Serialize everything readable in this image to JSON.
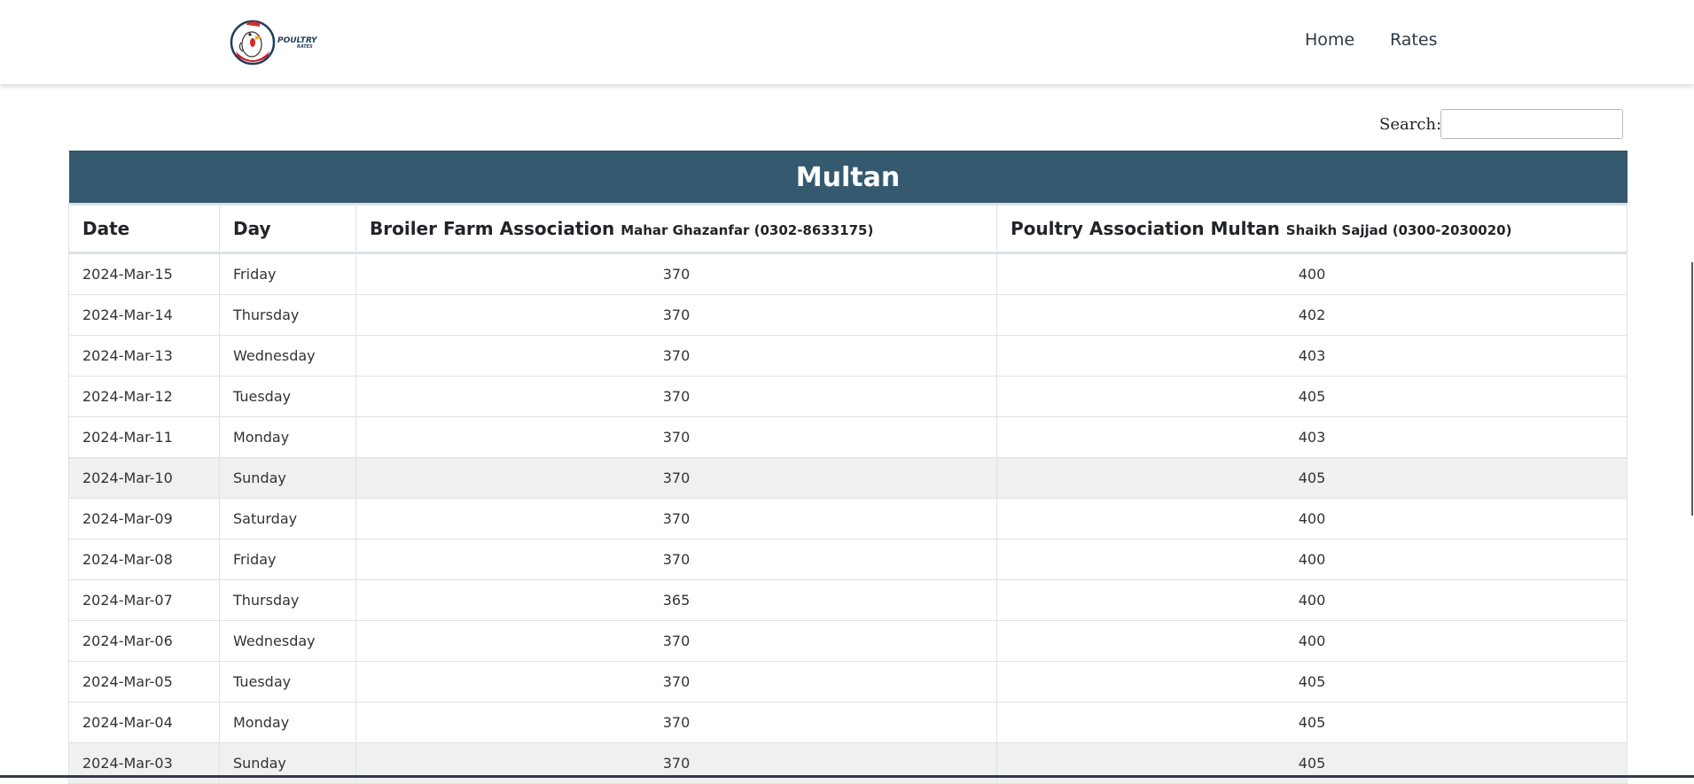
{
  "nav": {
    "logo_text": "POULTRY",
    "logo_sub": "RATES",
    "links": [
      "Home",
      "Rates"
    ]
  },
  "search": {
    "label": "Search:",
    "value": ""
  },
  "table": {
    "title": "Multan",
    "columns": [
      {
        "main": "Date",
        "sub": ""
      },
      {
        "main": "Day",
        "sub": ""
      },
      {
        "main": "Broiler Farm Association",
        "sub": "Mahar Ghazanfar (0302-8633175)"
      },
      {
        "main": "Poultry Association Multan",
        "sub": "Shaikh Sajjad (0300-2030020)"
      }
    ],
    "rows": [
      {
        "date": "2024-Mar-15",
        "day": "Friday",
        "broiler": "370",
        "poultry": "400"
      },
      {
        "date": "2024-Mar-14",
        "day": "Thursday",
        "broiler": "370",
        "poultry": "402"
      },
      {
        "date": "2024-Mar-13",
        "day": "Wednesday",
        "broiler": "370",
        "poultry": "403"
      },
      {
        "date": "2024-Mar-12",
        "day": "Tuesday",
        "broiler": "370",
        "poultry": "405"
      },
      {
        "date": "2024-Mar-11",
        "day": "Monday",
        "broiler": "370",
        "poultry": "403"
      },
      {
        "date": "2024-Mar-10",
        "day": "Sunday",
        "broiler": "370",
        "poultry": "405"
      },
      {
        "date": "2024-Mar-09",
        "day": "Saturday",
        "broiler": "370",
        "poultry": "400"
      },
      {
        "date": "2024-Mar-08",
        "day": "Friday",
        "broiler": "370",
        "poultry": "400"
      },
      {
        "date": "2024-Mar-07",
        "day": "Thursday",
        "broiler": "365",
        "poultry": "400"
      },
      {
        "date": "2024-Mar-06",
        "day": "Wednesday",
        "broiler": "370",
        "poultry": "400"
      },
      {
        "date": "2024-Mar-05",
        "day": "Tuesday",
        "broiler": "370",
        "poultry": "405"
      },
      {
        "date": "2024-Mar-04",
        "day": "Monday",
        "broiler": "370",
        "poultry": "405"
      },
      {
        "date": "2024-Mar-03",
        "day": "Sunday",
        "broiler": "370",
        "poultry": "405"
      }
    ]
  },
  "colors": {
    "title_bar": "#355a70",
    "sunday_row": "#f0f0f0",
    "nav_text": "#2b3a4a"
  }
}
